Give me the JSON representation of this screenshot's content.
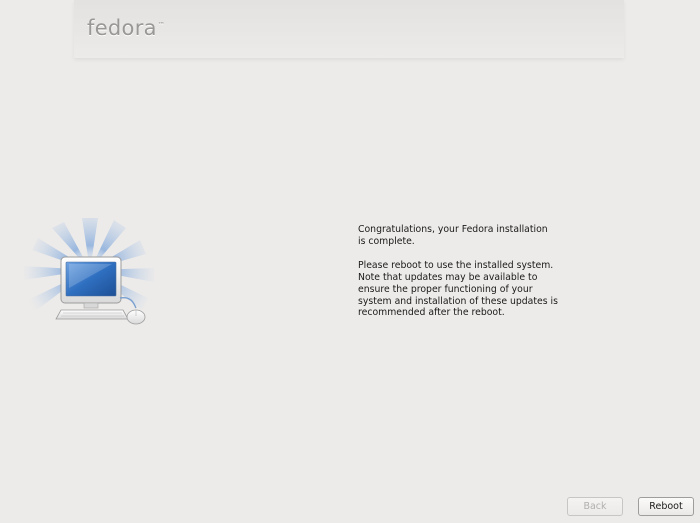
{
  "header": {
    "logo_text": "fedora"
  },
  "message": {
    "paragraph1": "Congratulations, your Fedora installation is complete.",
    "paragraph2": "Please reboot to use the installed system.  Note that updates may be available to ensure the proper functioning of your system and installation of these updates is recommended after the reboot."
  },
  "illustration": {
    "icon": "computer-icon"
  },
  "buttons": {
    "back_label": "Back",
    "back_enabled": false,
    "reboot_label": "Reboot"
  },
  "colors": {
    "background": "#edebe9",
    "logo": "#9a9896",
    "ray": "#a9c2e4",
    "screen": "#2f6fc0"
  }
}
